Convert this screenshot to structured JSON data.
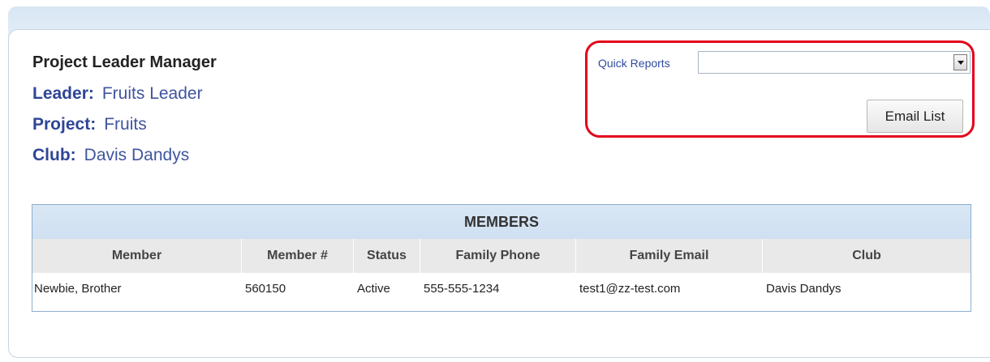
{
  "header": {
    "title": "Project Leader Manager",
    "leader_label": "Leader:",
    "leader_value": "Fruits Leader",
    "project_label": "Project:",
    "project_value": "Fruits",
    "club_label": "Club:",
    "club_value": "Davis Dandys"
  },
  "quick_reports": {
    "label": "Quick Reports",
    "selected": ""
  },
  "email_list_button": "Email List",
  "members": {
    "caption": "MEMBERS",
    "columns": [
      "Member",
      "Member #",
      "Status",
      "Family Phone",
      "Family Email",
      "Club"
    ],
    "rows": [
      [
        "Newbie, Brother",
        "560150",
        "Active",
        "555-555-1234",
        "test1@zz-test.com",
        "Davis Dandys"
      ]
    ]
  },
  "colors": {
    "highlight": "#e3001b",
    "link_blue": "#3f55a0",
    "table_header_blue": "#d9e7f5"
  }
}
